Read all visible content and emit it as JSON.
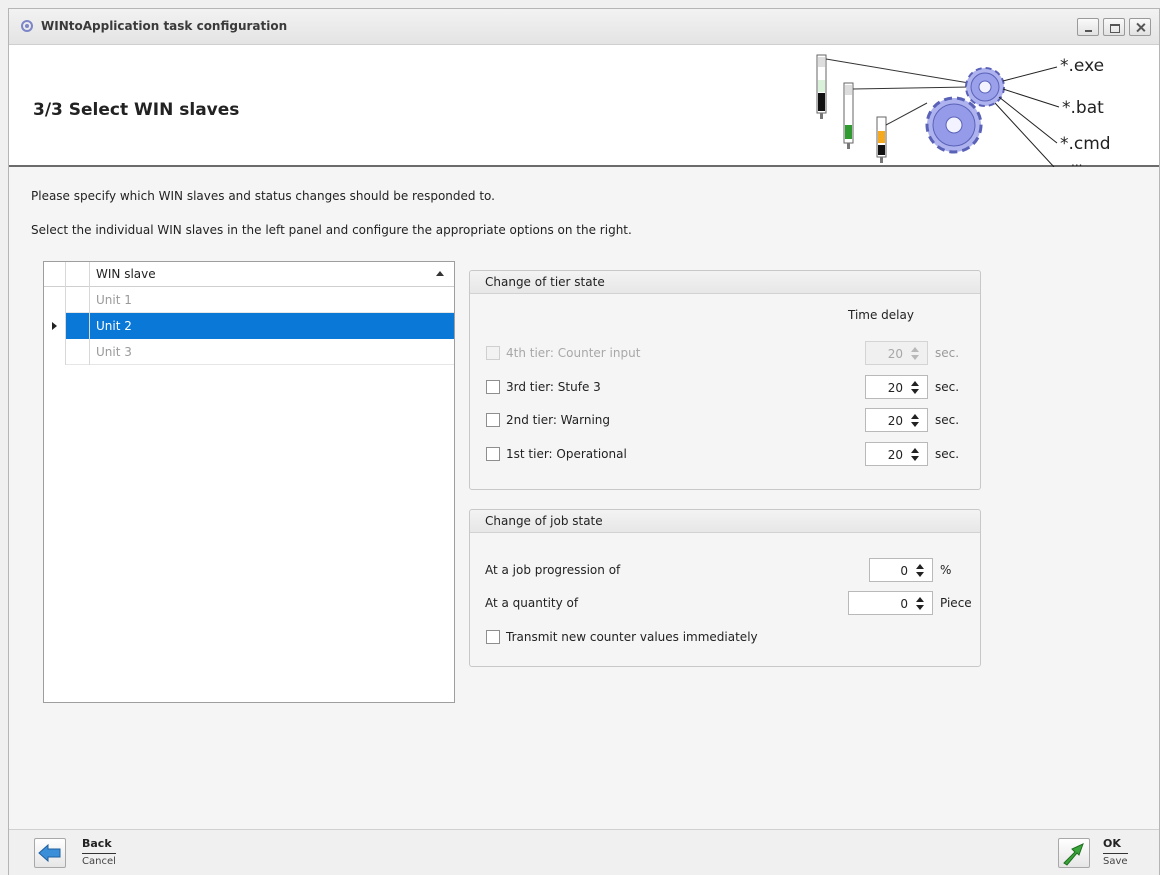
{
  "window": {
    "title": "WINtoApplication task configuration"
  },
  "header": {
    "title": "3/3 Select WIN slaves",
    "banner_labels": [
      "*.exe",
      "*.bat",
      "*.cmd",
      "..."
    ]
  },
  "instructions": {
    "line1": "Please specify which WIN slaves and status changes should be responded to.",
    "line2": "Select the individual WIN slaves in the left panel and configure the appropriate options on the right."
  },
  "slave_grid": {
    "column_header": "WIN slave",
    "rows": [
      {
        "label": "Unit 1",
        "selected": false
      },
      {
        "label": "Unit 2",
        "selected": true
      },
      {
        "label": "Unit 3",
        "selected": false
      }
    ]
  },
  "tier_group": {
    "title": "Change of tier state",
    "time_delay_label": "Time delay",
    "unit": "sec.",
    "rows": [
      {
        "label": "4th tier: Counter input",
        "value": "20",
        "enabled": false,
        "checked": false
      },
      {
        "label": "3rd tier: Stufe 3",
        "value": "20",
        "enabled": true,
        "checked": false
      },
      {
        "label": "2nd tier: Warning",
        "value": "20",
        "enabled": true,
        "checked": false
      },
      {
        "label": "1st tier: Operational",
        "value": "20",
        "enabled": true,
        "checked": false
      }
    ]
  },
  "job_group": {
    "title": "Change of job state",
    "progression_label": "At a job progression of",
    "progression_value": "0",
    "progression_unit": "%",
    "quantity_label": "At a quantity of",
    "quantity_value": "0",
    "quantity_unit": "Piece",
    "transmit_label": "Transmit new counter values immediately"
  },
  "footer": {
    "back_label": "Back",
    "back_sub": "Cancel",
    "ok_label": "OK",
    "ok_sub": "Save"
  },
  "colors": {
    "selection": "#0a78d7",
    "accent_green": "#3aa53a",
    "back_arrow": "#3b8fd9",
    "gear": "#8f95e6"
  }
}
